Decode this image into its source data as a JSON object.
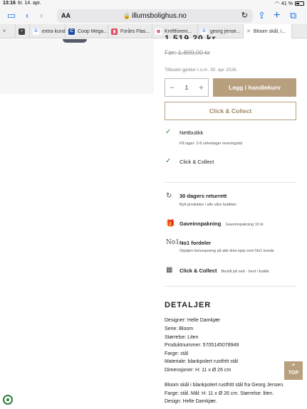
{
  "status_bar": {
    "time": "13:16",
    "date": "tir. 14. apr.",
    "battery": "41 %"
  },
  "toolbar": {
    "aa_label": "AA",
    "url": "illumsbolighus.no"
  },
  "tabs": [
    {
      "label": "extra kund",
      "favicon": "G"
    },
    {
      "label": "Coop Mega...",
      "favicon": "C"
    },
    {
      "label": "Forårs Flas...",
      "favicon": ""
    },
    {
      "label": "Kreftforeni...",
      "favicon": ""
    },
    {
      "label": "georg jense...",
      "favicon": "G"
    },
    {
      "label": "Bloom skål, i...",
      "favicon": ""
    }
  ],
  "product": {
    "price_partial": "1.519,20 kr",
    "old_price": "Før: 1.899,00 kr",
    "offer_note": "Tilbudet gjelder t.o.m. 30. apr 2026.",
    "quantity": "1",
    "minus": "−",
    "plus": "+",
    "add_to_cart": "Legg i handlekurv",
    "click_collect_button": "Click & Collect"
  },
  "availability": {
    "online_title": "Nettbutikk",
    "online_sub": "På lager: 2-6 virkedager leveringstid",
    "cc_title": "Click & Collect"
  },
  "benefits": {
    "returns_title": "30 dagers returrett",
    "returns_sub": "Bytt produkter i alle våre butikker",
    "gift_title": "Gaveinnpakning",
    "gift_sub": "Gaveinnpakning 15 kr.",
    "no1_icon_text": "No1",
    "no1_title": "No1 fordeler",
    "no1_sub": "Opptjen bonuspoeng på alle dine kjøp som No1 kunde",
    "cc_title": "Click & Collect",
    "cc_sub": "Bestill på nett - hent i butikk"
  },
  "details": {
    "heading": "DETALJER",
    "specs": [
      "Designer: Helle Damkjær",
      "Serie: Bloom",
      "Størrelse: Liten",
      "Produktnummer: 5705145078949",
      "Farge: stål",
      "Materiale: blankpolert rustfritt stål",
      "Dimensjoner: H: 11 x Ø 26 cm"
    ],
    "description": "Bloom skål i blankpolert rustfritt stål fra Georg Jensen. Farge: stål. Mål: H: 11 x Ø 26 cm. Størrelse: liten. Design: Helle Damkjær."
  },
  "top_button": "TOP",
  "colors": {
    "accent": "#b89f7e",
    "accent_dark": "#a18866",
    "check": "#3c8a3c",
    "link": "#1a73e8"
  }
}
